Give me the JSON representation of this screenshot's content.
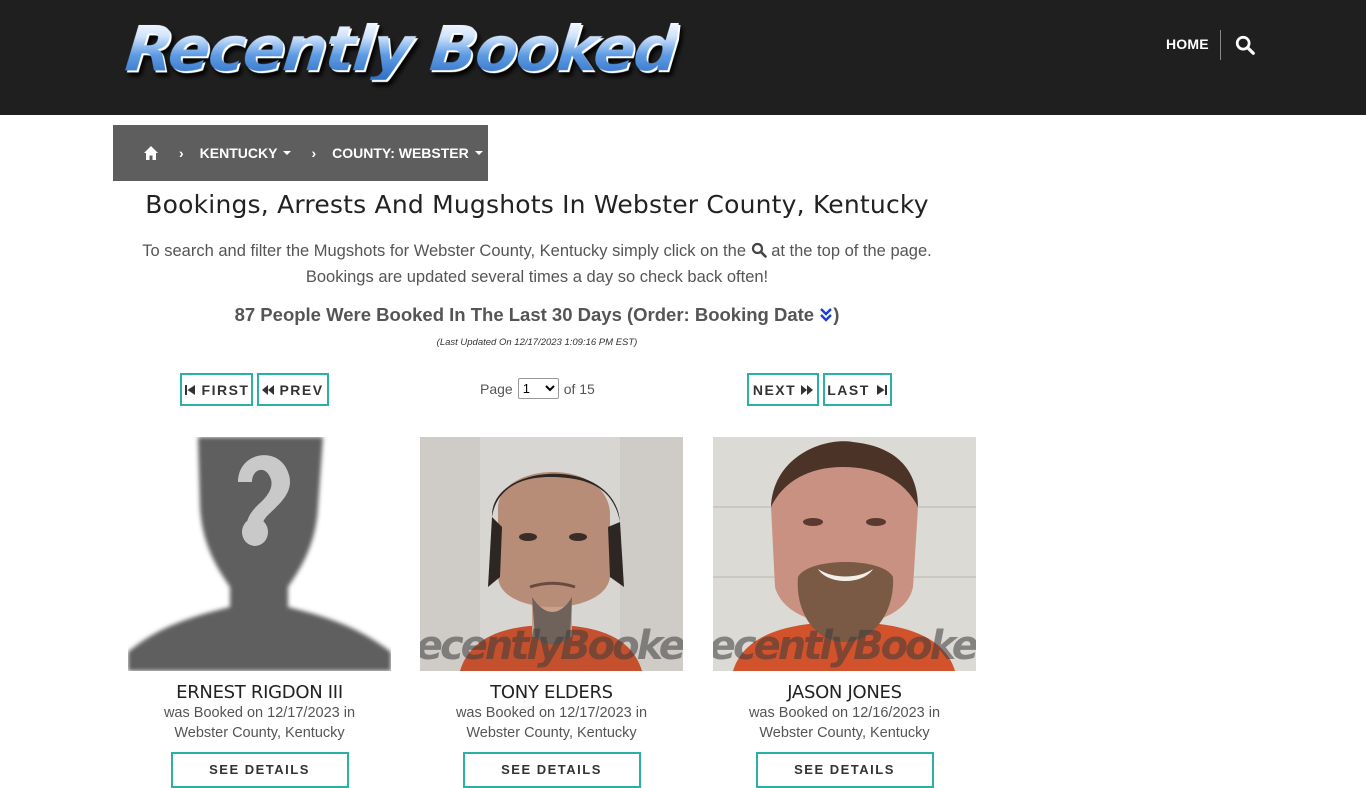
{
  "header": {
    "logo_text": "Recently Booked",
    "nav_home": "HOME",
    "search_icon": "search-icon"
  },
  "breadcrumb": {
    "home_icon": "home-icon",
    "state": "KENTUCKY",
    "county": "COUNTY: WEBSTER"
  },
  "main": {
    "title": "Bookings, Arrests And Mugshots In Webster County, Kentucky",
    "intro_before": "To search and filter the Mugshots for Webster County, Kentucky simply click on the",
    "intro_after": "at the top of the page.",
    "intro_line2": "Bookings are updated several times a day so check back often!",
    "count_text": "87 People Were Booked In The Last 30 Days (Order: Booking Date",
    "count_close": ")",
    "updated": "(Last Updated On 12/17/2023 1:09:16 PM EST)"
  },
  "pagination": {
    "first": "FIRST",
    "prev": "PREV",
    "next": "NEXT",
    "last": "LAST",
    "page_label": "Page",
    "current_page": "1",
    "of_label": "of 15"
  },
  "watermark": "RecentlyBooked.com",
  "bookings": [
    {
      "name": "ERNEST RIGDON III",
      "line1": "was Booked on 12/17/2023 in",
      "line2": "Webster County, Kentucky",
      "button": "SEE DETAILS",
      "photo": "placeholder-silhouette"
    },
    {
      "name": "TONY ELDERS",
      "line1": "was Booked on 12/17/2023 in",
      "line2": "Webster County, Kentucky",
      "button": "SEE DETAILS",
      "photo": "mugshot"
    },
    {
      "name": "JASON JONES",
      "line1": "was Booked on 12/16/2023 in",
      "line2": "Webster County, Kentucky",
      "button": "SEE DETAILS",
      "photo": "mugshot"
    }
  ],
  "colors": {
    "header_bg": "#1f1f1f",
    "breadcrumb_bg": "#5e5e5e",
    "accent_teal": "#2ab0a8",
    "sort_icon_blue": "#1a3fd1"
  }
}
